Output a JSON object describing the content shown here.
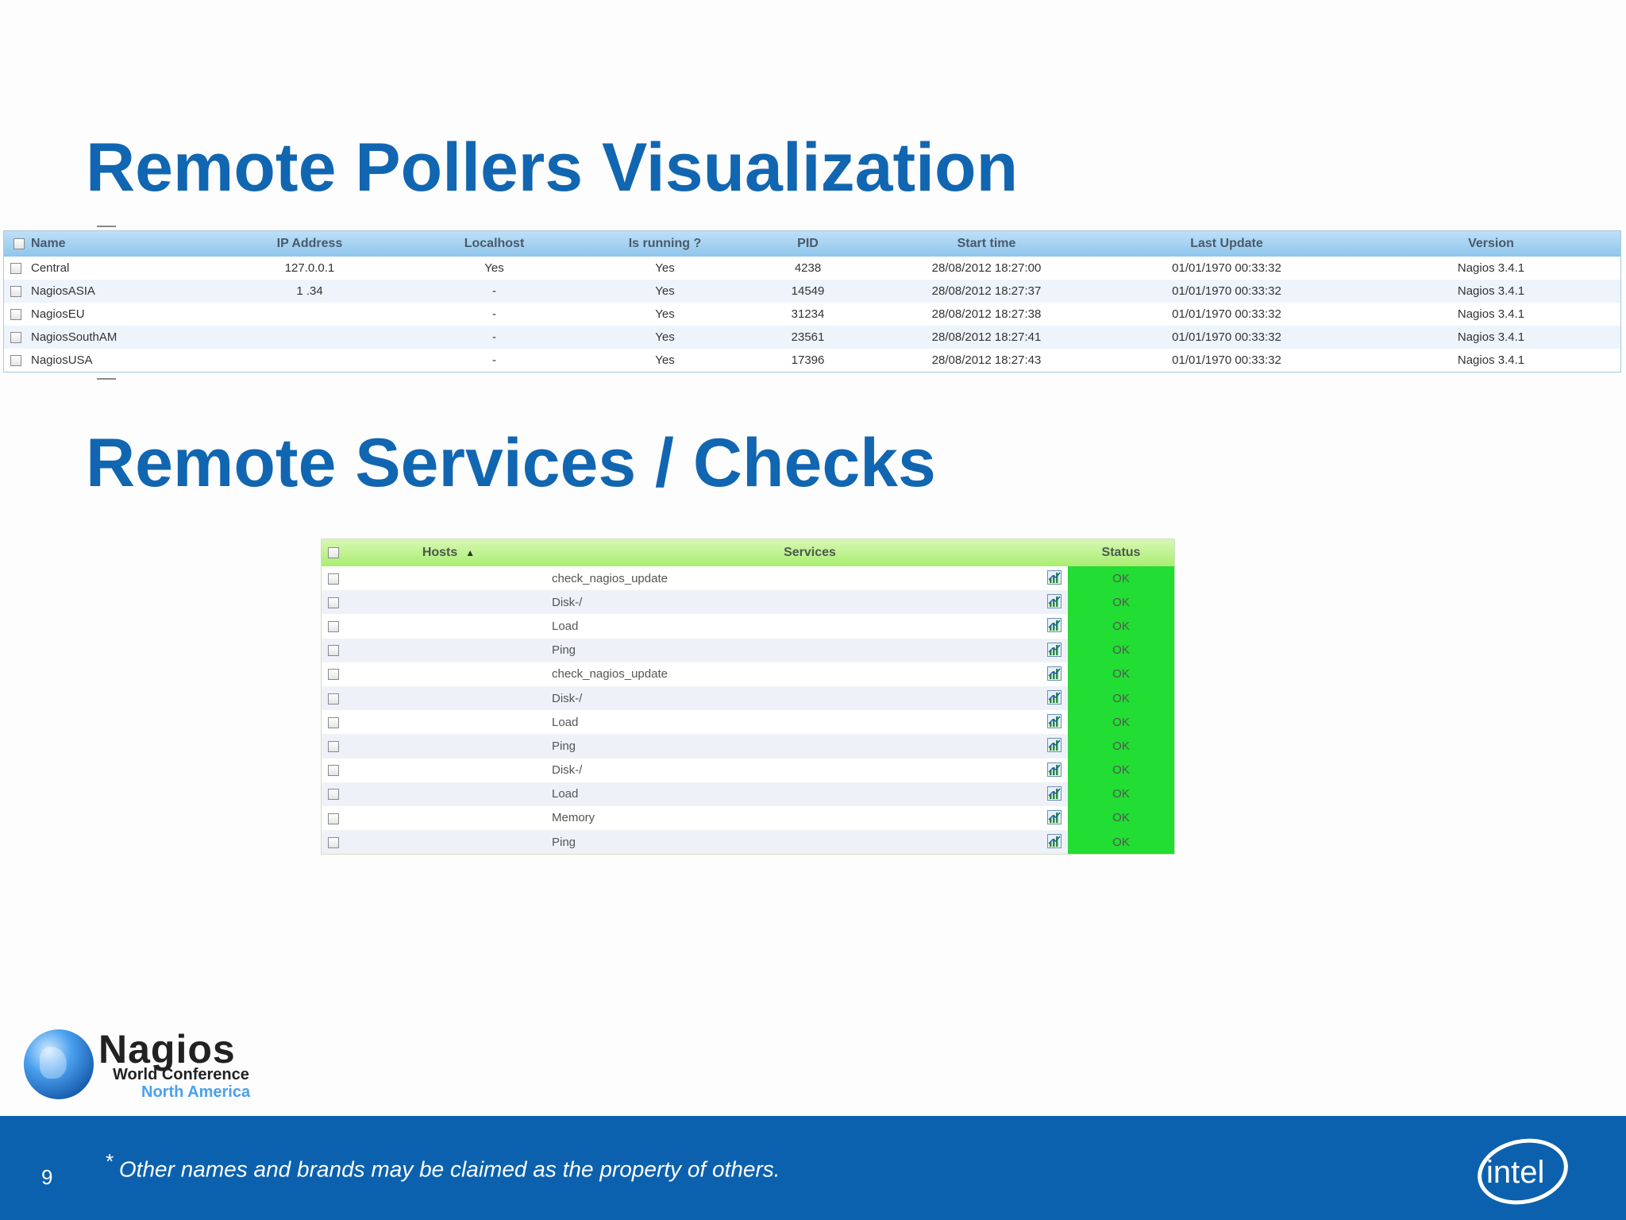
{
  "slide": {
    "title1": "Remote Pollers Visualization",
    "title2": "Remote Services / Checks",
    "page_number": "9",
    "disclaimer_mark": "*",
    "disclaimer": " Other names and brands may be claimed as the property of others."
  },
  "logo": {
    "name": "Nagios",
    "line1": "World Conference",
    "line2": "North America",
    "intel": "intel"
  },
  "pollers": {
    "headers": {
      "name": "Name",
      "ip": "IP Address",
      "localhost": "Localhost",
      "running": "Is running ?",
      "pid": "PID",
      "start": "Start time",
      "update": "Last Update",
      "version": "Version"
    },
    "rows": [
      {
        "name": "Central",
        "ip": "127.0.0.1",
        "localhost": "Yes",
        "running": "Yes",
        "pid": "4238",
        "start": "28/08/2012 18:27:00",
        "update": "01/01/1970 00:33:32",
        "version": "Nagios 3.4.1"
      },
      {
        "name": "NagiosASIA",
        "ip": "1 .34 ",
        "localhost": "-",
        "running": "Yes",
        "pid": "14549",
        "start": "28/08/2012 18:27:37",
        "update": "01/01/1970 00:33:32",
        "version": "Nagios 3.4.1"
      },
      {
        "name": "NagiosEU",
        "ip": "",
        "localhost": "-",
        "running": "Yes",
        "pid": "31234",
        "start": "28/08/2012 18:27:38",
        "update": "01/01/1970 00:33:32",
        "version": "Nagios 3.4.1"
      },
      {
        "name": "NagiosSouthAM",
        "ip": "",
        "localhost": "-",
        "running": "Yes",
        "pid": "23561",
        "start": "28/08/2012 18:27:41",
        "update": "01/01/1970 00:33:32",
        "version": "Nagios 3.4.1"
      },
      {
        "name": "NagiosUSA",
        "ip": "",
        "localhost": "-",
        "running": "Yes",
        "pid": "17396",
        "start": "28/08/2012 18:27:43",
        "update": "01/01/1970 00:33:32",
        "version": "Nagios 3.4.1"
      }
    ]
  },
  "services": {
    "headers": {
      "hosts": "Hosts",
      "services": "Services",
      "status": "Status"
    },
    "rows": [
      {
        "host": "",
        "service": "check_nagios_update",
        "status": "OK"
      },
      {
        "host": "",
        "service": "Disk-/",
        "status": "OK"
      },
      {
        "host": "",
        "service": "Load",
        "status": "OK"
      },
      {
        "host": "",
        "service": "Ping",
        "status": "OK"
      },
      {
        "host": "",
        "service": "check_nagios_update",
        "status": "OK"
      },
      {
        "host": "",
        "service": "Disk-/",
        "status": "OK"
      },
      {
        "host": "",
        "service": "Load",
        "status": "OK"
      },
      {
        "host": "",
        "service": "Ping",
        "status": "OK"
      },
      {
        "host": "",
        "service": "Disk-/",
        "status": "OK"
      },
      {
        "host": "",
        "service": "Load",
        "status": "OK"
      },
      {
        "host": "",
        "service": "Memory",
        "status": "OK"
      },
      {
        "host": "",
        "service": "Ping",
        "status": "OK"
      }
    ]
  },
  "colors": {
    "title": "#1166b1",
    "footer": "#0b61ad",
    "status_ok": "#22dd33"
  }
}
